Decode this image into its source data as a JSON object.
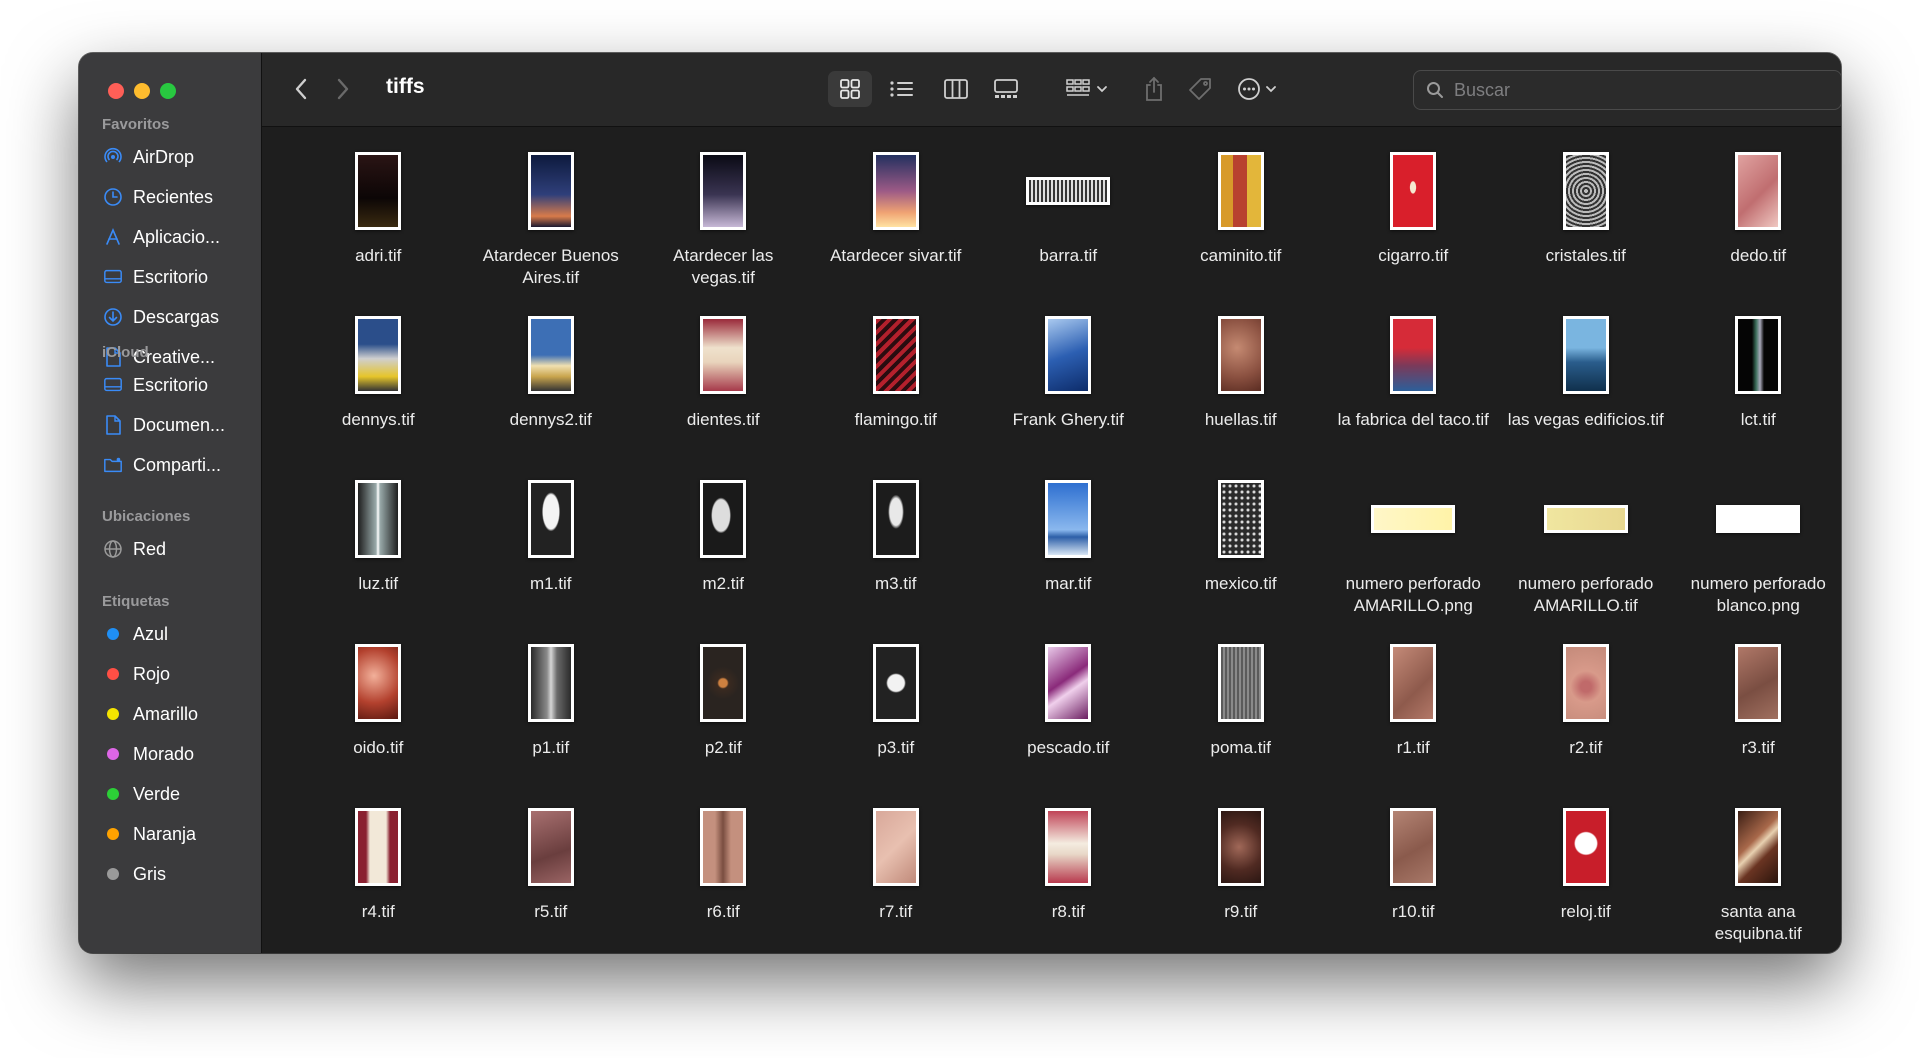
{
  "window": {
    "folder_title": "tiffs"
  },
  "sidebar": {
    "favorites_heading": "Favoritos",
    "favorites": [
      {
        "label": "AirDrop",
        "icon": "airdrop-icon"
      },
      {
        "label": "Recientes",
        "icon": "clock-icon"
      },
      {
        "label": "Aplicacio...",
        "icon": "applications-icon"
      },
      {
        "label": "Escritorio",
        "icon": "desktop-icon"
      },
      {
        "label": "Descargas",
        "icon": "download-icon"
      },
      {
        "label": "Creative...",
        "icon": "document-icon"
      }
    ],
    "icloud_heading": "iCloud",
    "icloud": [
      {
        "label": "Escritorio",
        "icon": "desktop-icon"
      },
      {
        "label": "Documen...",
        "icon": "document-icon"
      },
      {
        "label": "Comparti...",
        "icon": "shared-folder-icon"
      }
    ],
    "locations_heading": "Ubicaciones",
    "locations": [
      {
        "label": "Red",
        "icon": "network-icon"
      }
    ],
    "tags_heading": "Etiquetas",
    "tags": [
      {
        "label": "Azul",
        "color": "#1f8ff5"
      },
      {
        "label": "Rojo",
        "color": "#ff4f45"
      },
      {
        "label": "Amarillo",
        "color": "#f5e400"
      },
      {
        "label": "Morado",
        "color": "#dd66e6"
      },
      {
        "label": "Verde",
        "color": "#2ccf37"
      },
      {
        "label": "Naranja",
        "color": "#ffa200"
      },
      {
        "label": "Gris",
        "color": "#9a9a9a"
      }
    ]
  },
  "toolbar": {
    "search_placeholder": "Buscar",
    "accent_color": "#3a8bf7"
  },
  "files": [
    {
      "name": "adri.tif",
      "bg": "linear-gradient(180deg,#2a1414,#0c0606 60%,#3a2a10)"
    },
    {
      "name": "Atardecer Buenos Aires.tif",
      "bg": "linear-gradient(180deg,#0d1a3d,#2f3f7a 55%,#d87b4a 85%,#1c1a30)"
    },
    {
      "name": "Atardecer las vegas.tif",
      "bg": "linear-gradient(180deg,#0a0a14,#3a3452 55%,#c7b8d6)"
    },
    {
      "name": "Atardecer sivar.tif",
      "bg": "linear-gradient(180deg,#23305f,#9c5a86 50%,#f0a373 80%,#ffe2a2)"
    },
    {
      "name": "barra.tif",
      "bg": "repeating-linear-gradient(90deg,#333 0 2px,#ddd 2px 4px)",
      "wide": true
    },
    {
      "name": "caminito.tif",
      "bg": "linear-gradient(90deg,#d89a2a 30%,#b8412f 30% 65%,#e3b63a 65%)"
    },
    {
      "name": "cigarro.tif",
      "bg": "radial-gradient(ellipse at 50% 45%,#f5e8d0 0 10%,#d91f2b 12%)"
    },
    {
      "name": "cristales.tif",
      "bg": "repeating-radial-gradient(circle at 50% 50%,#bbb 0 2px,#333 2px 4px)"
    },
    {
      "name": "dedo.tif",
      "bg": "linear-gradient(135deg,#e0a2a0,#c06e70 55%,#f0c8c2)"
    },
    {
      "name": "dennys.tif",
      "bg": "linear-gradient(180deg,#2b4e8a 35%,#cfcfcf 55%,#e6c52a 80%,#333)"
    },
    {
      "name": "dennys2.tif",
      "bg": "linear-gradient(180deg,#3d6fb5 50%,#f0e0b0 65%,#c9a54d 80%,#333)"
    },
    {
      "name": "dientes.tif",
      "bg": "linear-gradient(180deg,#9a2a3a,#efe1cc 40%,#e9d4bc 60%,#a63a4a)"
    },
    {
      "name": "flamingo.tif",
      "bg": "repeating-linear-gradient(135deg,#b3202c 0 4px,#2a0c10 4px 8px)"
    },
    {
      "name": "Frank Ghery.tif",
      "bg": "linear-gradient(160deg,#a9c9ef,#2c5fb2 50%,#0d2c6a)"
    },
    {
      "name": "huellas.tif",
      "bg": "radial-gradient(circle at 40% 40%,#c58a72,#8a5040 60%,#5a2c22)"
    },
    {
      "name": "la fabrica del taco.tif",
      "bg": "linear-gradient(180deg,#d62b38 40%,#7a3a5a 65%,#2c5f9a)"
    },
    {
      "name": "las vegas edificios.tif",
      "bg": "linear-gradient(180deg,#7ab5e0 40%,#2a5d8c 60%,#10304c)"
    },
    {
      "name": "lct.tif",
      "bg": "linear-gradient(90deg,#050505 35%,#3a6d5a 45%,#aab 55%,#050505 65%)"
    },
    {
      "name": "luz.tif",
      "bg": "linear-gradient(90deg,#1e1e1e,#9aa 45%,#fff 50%,#9aa 55%,#1e1e1e)"
    },
    {
      "name": "m1.tif",
      "bg": "radial-gradient(ellipse at 50% 40%,#f4f4f4 0 28%,#222 32%)"
    },
    {
      "name": "m2.tif",
      "bg": "radial-gradient(ellipse at 45% 45%,#ddd 0 28%,#1a1a1a 32%)"
    },
    {
      "name": "m3.tif",
      "bg": "radial-gradient(ellipse at 50% 40%,#e8e8e8 0 22%,#1c1c1c 28%)"
    },
    {
      "name": "mar.tif",
      "bg": "linear-gradient(180deg,#2e6fd0,#8ab8ee 65%,#2d5fa8 75%,#d8e6f4)"
    },
    {
      "name": "mexico.tif",
      "bg": "radial-gradient(circle,#ddd 1px,#2b2b2b 2px) 0 0/6px 6px"
    },
    {
      "name": "numero perforado AMARILLO.png",
      "bg": "linear-gradient(90deg,#fff7c8,#fff3a8)",
      "wide": true
    },
    {
      "name": "numero perforado AMARILLO.tif",
      "bg": "linear-gradient(90deg,#f0e6a0,#e8d890)",
      "wide": true
    },
    {
      "name": "numero perforado blanco.png",
      "bg": "#ffffff",
      "wide": true
    },
    {
      "name": "oido.tif",
      "bg": "radial-gradient(circle at 40% 40%,#f2b09a,#b3412e 55%,#5a1810)"
    },
    {
      "name": "p1.tif",
      "bg": "linear-gradient(90deg,#2a2a2a,#8a8a8a 40%,#d5d5d5 50%,#6a6a6a 65%,#2a2a2a)"
    },
    {
      "name": "p2.tif",
      "bg": "radial-gradient(circle at 50% 50%,#cc8040 0 10%,#3a2a20 14%,#2a2420 40%)"
    },
    {
      "name": "p3.tif",
      "bg": "radial-gradient(circle at 50% 50%,#f2f2f2 0 20%,#222 24%)"
    },
    {
      "name": "pescado.tif",
      "bg": "linear-gradient(145deg,#e8c8e8,#8a2a7a 45%,#f0d0ec 60%,#6a1e60)"
    },
    {
      "name": "poma.tif",
      "bg": "repeating-linear-gradient(90deg,#5a5a5a 0 2px,#8a8a8a 2px 4px)"
    },
    {
      "name": "r1.tif",
      "bg": "linear-gradient(135deg,#c48a78,#8e5a4c 60%,#b37868)"
    },
    {
      "name": "r2.tif",
      "bg": "radial-gradient(circle at 50% 55%,#c06a6a 0 12%,#d89a8a 35%,#c48a7a)"
    },
    {
      "name": "r3.tif",
      "bg": "linear-gradient(150deg,#b07868,#7a4e42 55%,#a07060)"
    },
    {
      "name": "r4.tif",
      "bg": "linear-gradient(90deg,#8a2030 20%,#f2e8d8 30% 70%,#8a2030 80%)"
    },
    {
      "name": "r5.tif",
      "bg": "linear-gradient(160deg,#a87070,#6a3e3e 60%,#9a6464)"
    },
    {
      "name": "r6.tif",
      "bg": "linear-gradient(90deg,#c4907e 30%,#7a4e40 50%,#c4907e 70%)"
    },
    {
      "name": "r7.tif",
      "bg": "linear-gradient(135deg,#d8a89a,#e8c0b0 50%,#c08a7a)"
    },
    {
      "name": "r8.tif",
      "bg": "linear-gradient(180deg,#c04458,#f4ece0 45%,#e8d8c8 60%,#b83a4e)"
    },
    {
      "name": "r9.tif",
      "bg": "radial-gradient(circle at 45% 50%,#a06858,#502a22 55%,#2a1612)"
    },
    {
      "name": "r10.tif",
      "bg": "linear-gradient(150deg,#b48474,#8a5a4c 55%,#a87868)"
    },
    {
      "name": "reloj.tif",
      "bg": "radial-gradient(circle at 50% 45%,#fff 0 24%,#c81e2a 27%)"
    },
    {
      "name": "santa ana esquibna.tif",
      "bg": "linear-gradient(135deg,#3a1e14,#a8684a 40%,#e8d0b0 50%,#6a3422 65%,#2a140c)"
    }
  ]
}
